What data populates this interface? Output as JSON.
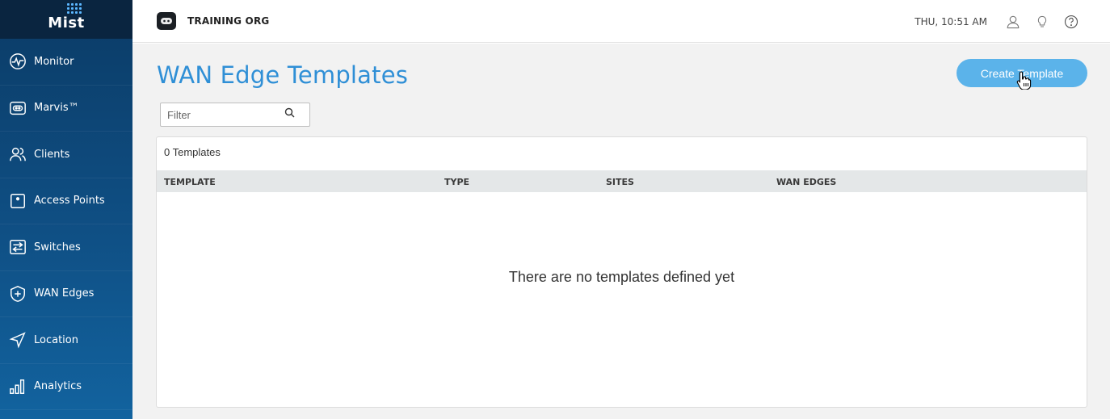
{
  "brand": {
    "logo_text": "Mist"
  },
  "sidebar": {
    "items": [
      {
        "label": "Monitor",
        "icon": "monitor-icon"
      },
      {
        "label": "Marvis™",
        "icon": "marvis-icon"
      },
      {
        "label": "Clients",
        "icon": "clients-icon"
      },
      {
        "label": "Access Points",
        "icon": "access-point-icon"
      },
      {
        "label": "Switches",
        "icon": "switches-icon"
      },
      {
        "label": "WAN Edges",
        "icon": "wan-edge-icon"
      },
      {
        "label": "Location",
        "icon": "location-icon"
      },
      {
        "label": "Analytics",
        "icon": "analytics-icon"
      }
    ]
  },
  "header": {
    "org_name": "TRAINING ORG",
    "clock": "THU, 10:51 AM",
    "icons": [
      "user-icon",
      "lightbulb-icon",
      "help-icon"
    ]
  },
  "main": {
    "title": "WAN Edge Templates",
    "create_button_label": "Create Template",
    "filter": {
      "placeholder": "Filter",
      "value": ""
    },
    "count_label": "0 Templates",
    "columns": [
      "TEMPLATE",
      "TYPE",
      "SITES",
      "WAN EDGES"
    ],
    "rows": [],
    "empty_message": "There are no templates defined yet"
  },
  "colors": {
    "accent": "#2f8fd6",
    "button": "#5bb3ea",
    "sidebar_top": "#0b3b66",
    "sidebar_bottom": "#12639f"
  }
}
